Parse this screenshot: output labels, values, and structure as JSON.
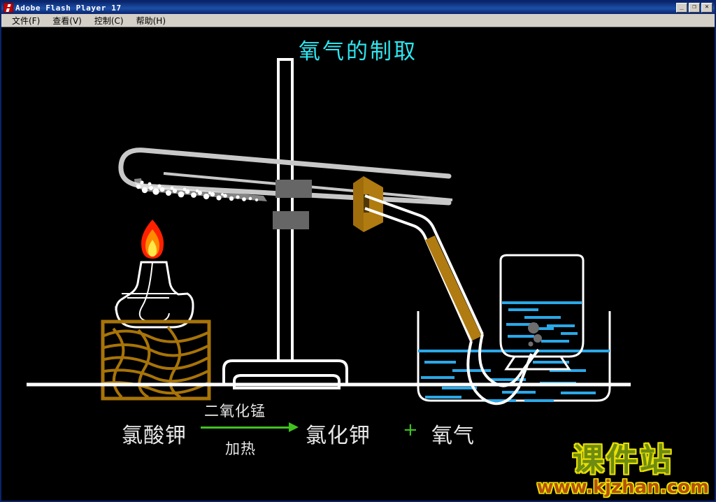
{
  "window": {
    "title": "Adobe Flash Player 17",
    "app_icon": "flash-logo-icon",
    "buttons": {
      "minimize": "_",
      "restore": "❐",
      "close": "✕"
    }
  },
  "menu": {
    "items": [
      {
        "label": "文件(F)",
        "name": "file"
      },
      {
        "label": "查看(V)",
        "name": "view"
      },
      {
        "label": "控制(C)",
        "name": "control"
      },
      {
        "label": "帮助(H)",
        "name": "help"
      }
    ]
  },
  "stage": {
    "title": "氧气的制取",
    "title_color": "#2ee6f0",
    "background": "#000000"
  },
  "equation": {
    "reactant": "氯酸钾",
    "catalyst_above": "二氧化锰",
    "condition_below": "加热",
    "arrow_color": "#3fc21f",
    "product_1": "氯化钾",
    "plus": "+",
    "product_2": "氧气",
    "text_color": "#e8e8e8"
  },
  "watermark": {
    "brand": "课件站",
    "url": "www.kjzhan.com",
    "brand_color": "#6e8b12",
    "brand_outline": "#e8e000",
    "url_color": "#b5500c",
    "url_outline": "#f0e800"
  },
  "apparatus": {
    "colors": {
      "glass": "#ffffff",
      "clamp": "#666666",
      "wood": "#a87408",
      "stopper": "#b07b10",
      "water": "#2aa8e8",
      "powder": "#ffffff",
      "flame_outer": "#ff2000",
      "flame_mid": "#ff8c00",
      "flame_core": "#ffe84a",
      "bubble": "#6e6e6e",
      "tube_glass": "#c8c8c8"
    },
    "parts": [
      {
        "name": "test-tube",
        "label": "试管"
      },
      {
        "name": "potassium-chlorate-powder",
        "label": "氯酸钾粉末"
      },
      {
        "name": "alcohol-lamp",
        "label": "酒精灯"
      },
      {
        "name": "flame",
        "label": "火焰"
      },
      {
        "name": "wooden-block",
        "label": "木块"
      },
      {
        "name": "iron-stand",
        "label": "铁架台"
      },
      {
        "name": "clamp-upper",
        "label": "上夹"
      },
      {
        "name": "clamp-lower",
        "label": "下夹"
      },
      {
        "name": "rubber-stopper",
        "label": "橡皮塞"
      },
      {
        "name": "delivery-tube",
        "label": "导气管"
      },
      {
        "name": "water-trough",
        "label": "水槽"
      },
      {
        "name": "gas-collecting-bottle",
        "label": "集气瓶"
      },
      {
        "name": "gas-bubbles",
        "label": "气泡"
      },
      {
        "name": "bench-line",
        "label": "桌面"
      }
    ]
  }
}
